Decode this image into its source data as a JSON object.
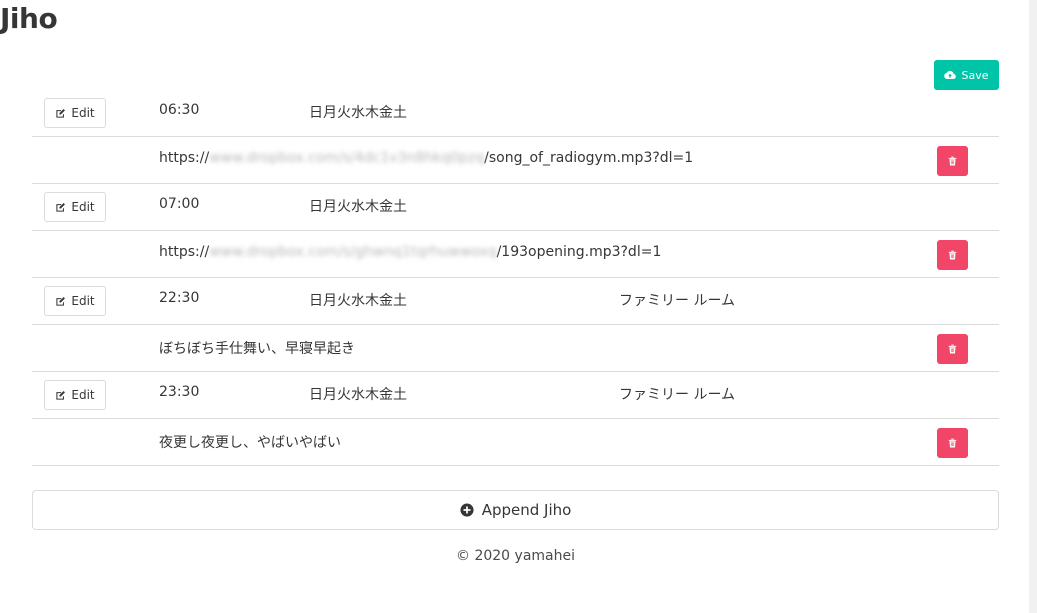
{
  "app": {
    "title": "Jiho"
  },
  "toolbar": {
    "save_label": "Save",
    "save_icon": "cloud-upload-icon"
  },
  "colors": {
    "save": "#00c4a7",
    "delete": "#f14668",
    "border": "#dbdbdb",
    "text": "#363636"
  },
  "entries": [
    {
      "edit_label": "Edit",
      "time": "06:30",
      "days": "日月火水木金土",
      "device": "",
      "content_prefix": "https://",
      "content_blurred": "www.dropbox.com/s/4dc1v3n8hkq0pzq",
      "content_suffix": "/song_of_radiogym.mp3?dl=1"
    },
    {
      "edit_label": "Edit",
      "time": "07:00",
      "days": "日月火水木金土",
      "device": "",
      "content_prefix": "https://",
      "content_blurred": "www.dropbox.com/s/ghwnq1tqrhuwwoxq",
      "content_suffix": "/193opening.mp3?dl=1"
    },
    {
      "edit_label": "Edit",
      "time": "22:30",
      "days": "日月火水木金土",
      "device": "ファミリー ルーム",
      "content_prefix": "ぼちぼち手仕舞い、早寝早起き",
      "content_blurred": "",
      "content_suffix": ""
    },
    {
      "edit_label": "Edit",
      "time": "23:30",
      "days": "日月火水木金土",
      "device": "ファミリー ルーム",
      "content_prefix": "夜更し夜更し、やばいやばい",
      "content_blurred": "",
      "content_suffix": ""
    }
  ],
  "append": {
    "label": "Append Jiho",
    "icon": "plus-circle-icon"
  },
  "footer": {
    "text": "© 2020 yamahei"
  }
}
